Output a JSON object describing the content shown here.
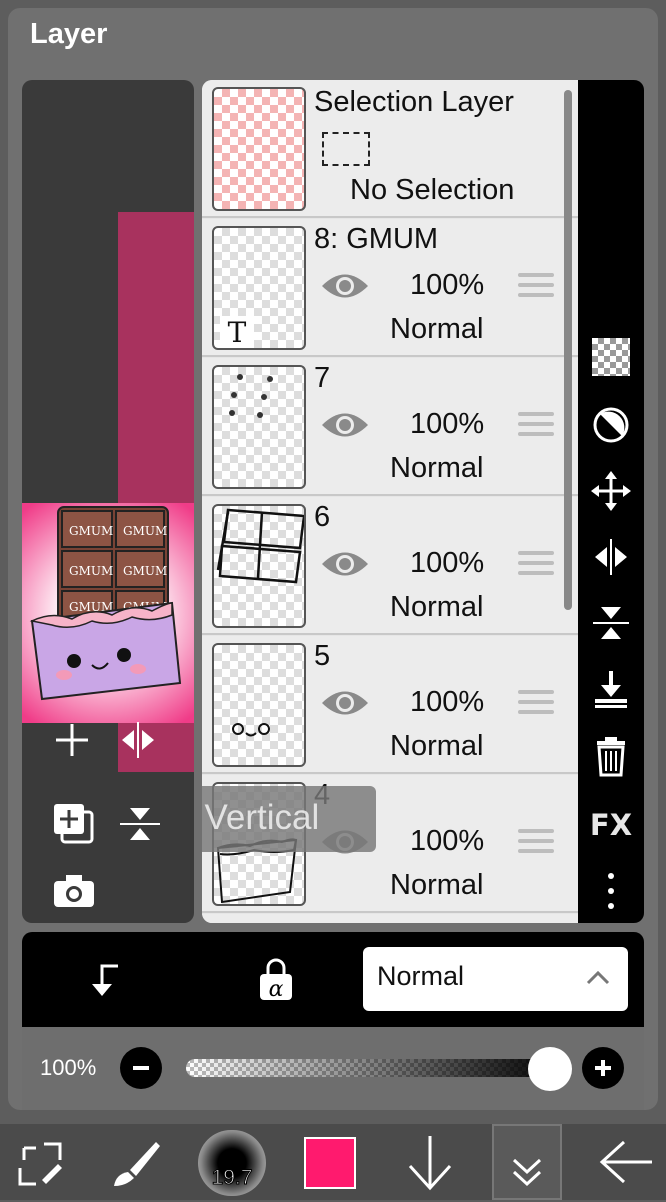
{
  "panel": {
    "title": "Layer"
  },
  "selection_layer": {
    "name": "Selection Layer",
    "status": "No Selection"
  },
  "layers": [
    {
      "name": "8: GMUM",
      "opacity": "100%",
      "blend": "Normal",
      "thumb": "text",
      "thumb_glyph": "T"
    },
    {
      "name": "7",
      "opacity": "100%",
      "blend": "Normal",
      "thumb": "dots"
    },
    {
      "name": "6",
      "opacity": "100%",
      "blend": "Normal",
      "thumb": "grid"
    },
    {
      "name": "5",
      "opacity": "100%",
      "blend": "Normal",
      "thumb": "face"
    },
    {
      "name": "4",
      "opacity": "100%",
      "blend": "Normal",
      "thumb": "bar"
    }
  ],
  "preview": {
    "label": "GMUM"
  },
  "left_tools": [
    "add-layer-icon",
    "flip-horizontal-icon",
    "duplicate-layer-icon",
    "flip-vertical-icon",
    "camera-icon"
  ],
  "right_tools": [
    "transparency-checker-icon",
    "clip-circle-icon",
    "move-icon",
    "flip-horizontal-icon",
    "flip-vertical-icon",
    "merge-down-icon",
    "trash-icon",
    "fx-icon",
    "more-vertical-icon"
  ],
  "right_tools_fx_label": "FX",
  "bottom": {
    "blend_mode": "Normal",
    "clip_icon": "clip-arrow-icon",
    "lock_icon": "alpha-lock-icon",
    "lock_glyph": "α"
  },
  "opacity_slider": {
    "value_label": "100%",
    "value": 1.0
  },
  "toast": {
    "text": "Flip Canvas Vertical"
  },
  "toolbar": {
    "brush_size": "19.7",
    "color": "#ff1a6e",
    "items": [
      "transform-icon",
      "brush-icon",
      "brush-size-icon",
      "color-swatch",
      "download-arrow-icon",
      "layer-collapse-icon",
      "back-arrow-icon"
    ]
  },
  "colors": {
    "panel": "#707070",
    "accent": "#ff1a6e",
    "toolbar": "#4b4b4b"
  }
}
